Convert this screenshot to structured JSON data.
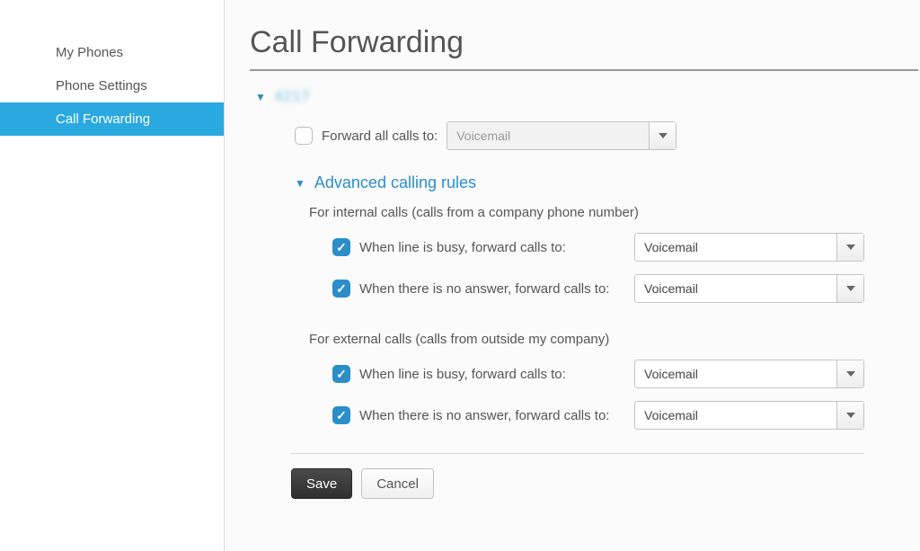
{
  "sidebar": {
    "items": [
      {
        "label": "My Phones"
      },
      {
        "label": "Phone Settings"
      },
      {
        "label": "Call Forwarding"
      }
    ]
  },
  "page": {
    "title": "Call Forwarding"
  },
  "line": {
    "label": "4217"
  },
  "forward_all": {
    "label": "Forward all calls to:",
    "value": "Voicemail",
    "checked": false
  },
  "advanced": {
    "title": "Advanced calling rules",
    "internal": {
      "title": "For internal calls (calls from a company phone number)",
      "busy": {
        "label": "When line is busy, forward calls to:",
        "value": "Voicemail",
        "checked": true
      },
      "no_answer": {
        "label": "When there is no answer, forward calls to:",
        "value": "Voicemail",
        "checked": true
      }
    },
    "external": {
      "title": "For external calls (calls from outside my company)",
      "busy": {
        "label": "When line is busy, forward calls to:",
        "value": "Voicemail",
        "checked": true
      },
      "no_answer": {
        "label": "When there is no answer, forward calls to:",
        "value": "Voicemail",
        "checked": true
      }
    }
  },
  "buttons": {
    "save": "Save",
    "cancel": "Cancel"
  }
}
